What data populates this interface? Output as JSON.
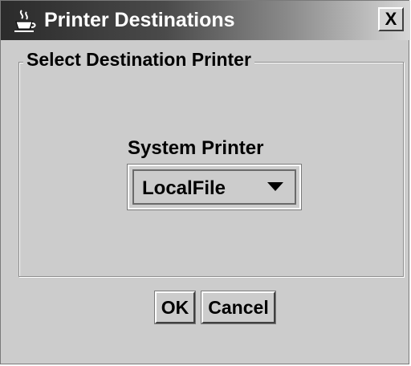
{
  "window": {
    "title": "Printer Destinations",
    "close_label": "X",
    "icon": "java-coffee-cup-icon"
  },
  "group": {
    "title": "Select Destination Printer"
  },
  "printer": {
    "label": "System Printer",
    "selected": "LocalFile",
    "dropdown_icon": "triangle-down-icon"
  },
  "buttons": {
    "ok_label": "OK",
    "cancel_label": "Cancel"
  },
  "colors": {
    "window_bg": "#cccccc",
    "title_gradient_start": "#2b2b2b",
    "title_gradient_end": "#d7d7d7",
    "title_text": "#ffffff"
  }
}
